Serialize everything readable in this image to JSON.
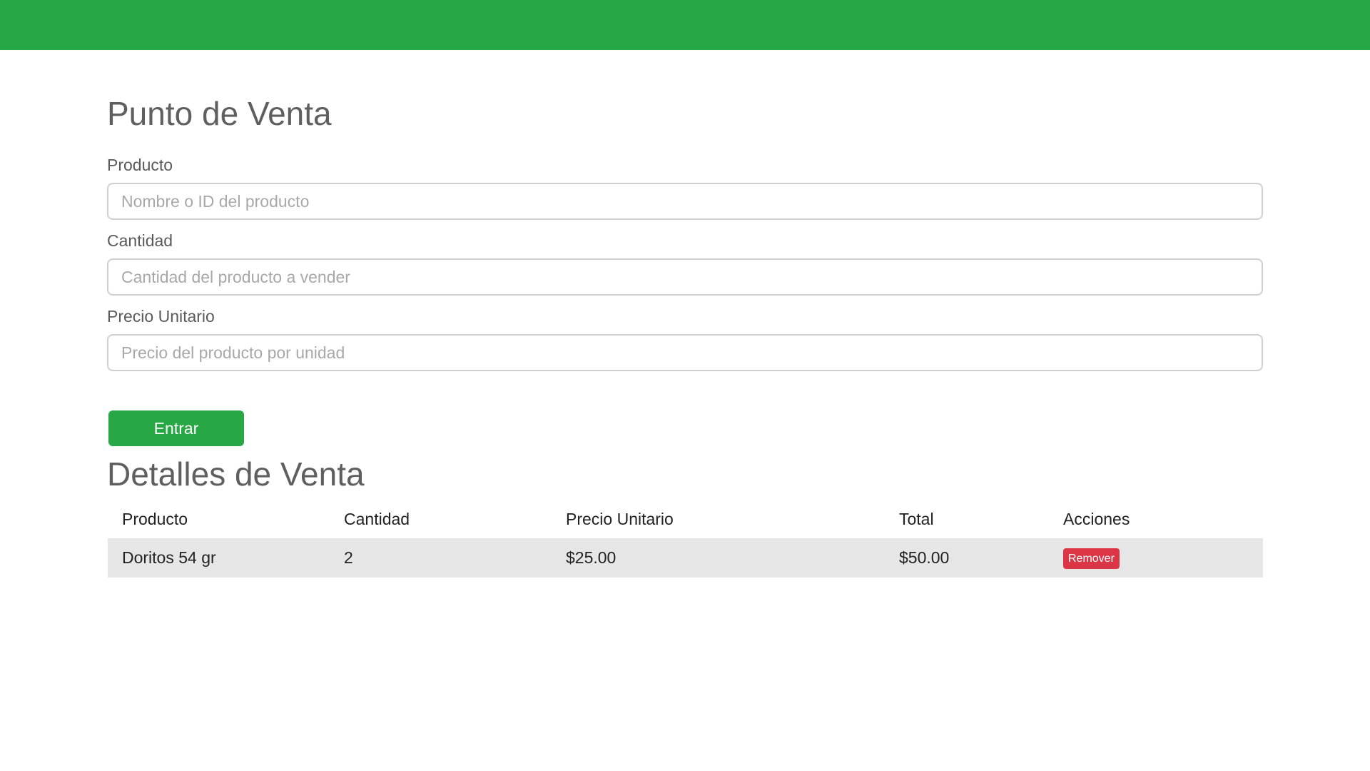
{
  "colors": {
    "brand": "#28a745",
    "danger": "#dc3545",
    "row_background": "#e6e6e6"
  },
  "page": {
    "title": "Punto de Venta"
  },
  "form": {
    "product": {
      "label": "Producto",
      "placeholder": "Nombre o ID del producto",
      "value": ""
    },
    "quantity": {
      "label": "Cantidad",
      "placeholder": "Cantidad del producto a vender",
      "value": ""
    },
    "unit_price": {
      "label": "Precio Unitario",
      "placeholder": "Precio del producto por unidad",
      "value": ""
    },
    "submit_label": "Entrar"
  },
  "details": {
    "title": "Detalles de Venta",
    "columns": [
      "Producto",
      "Cantidad",
      "Precio Unitario",
      "Total",
      "Acciones"
    ],
    "rows": [
      {
        "product": "Doritos 54 gr",
        "quantity": "2",
        "unit_price": "$25.00",
        "total": "$50.00",
        "action_label": "Remover"
      }
    ]
  }
}
